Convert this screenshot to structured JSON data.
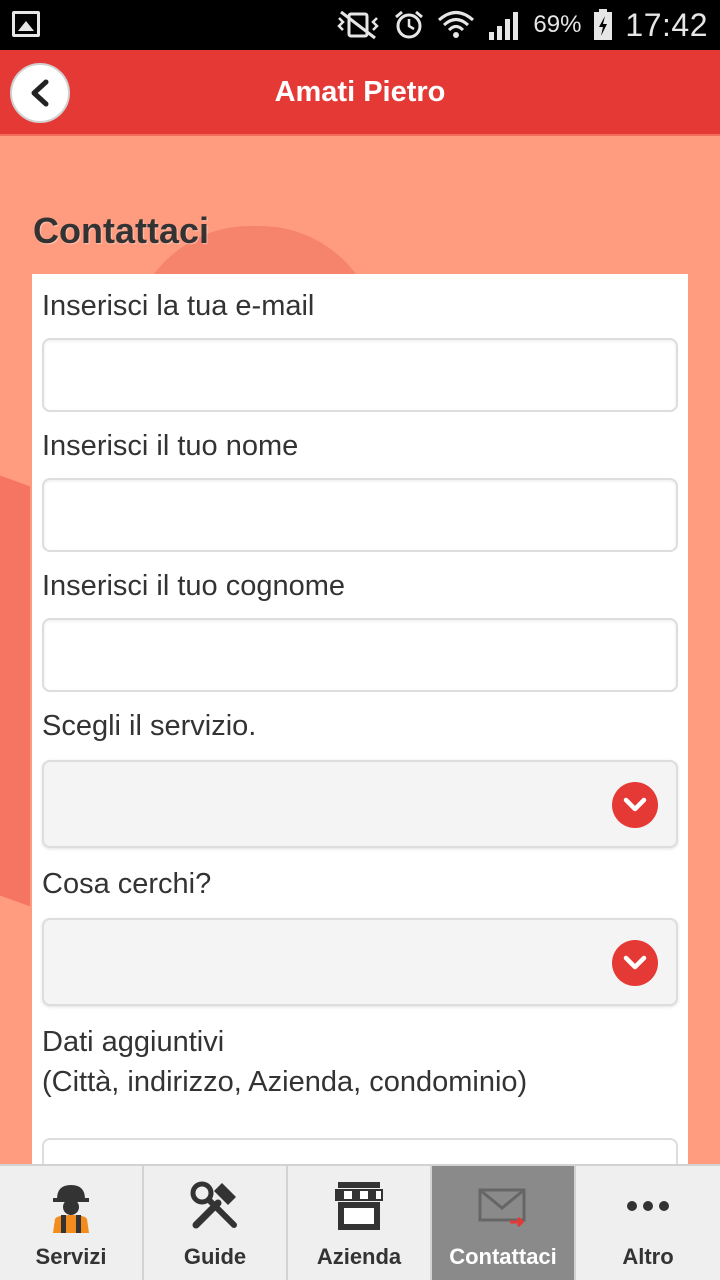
{
  "status_bar": {
    "battery_percent": "69%",
    "time": "17:42"
  },
  "header": {
    "title": "Amati Pietro"
  },
  "section": {
    "title": "Contattaci"
  },
  "form": {
    "email_label": "Inserisci la tua e-mail",
    "email_value": "",
    "name_label": "Inserisci il tuo nome",
    "name_value": "",
    "surname_label": "Inserisci il tuo cognome",
    "surname_value": "",
    "service_label": "Scegli il servizio.",
    "service_selected": "",
    "search_label": "Cosa cerchi?",
    "search_selected": "",
    "extra_label_line1": "Dati aggiuntivi",
    "extra_label_line2": "(Città, indirizzo, Azienda, condominio)"
  },
  "tabs": [
    {
      "label": "Servizi",
      "icon": "worker-icon"
    },
    {
      "label": "Guide",
      "icon": "tools-icon"
    },
    {
      "label": "Azienda",
      "icon": "shop-icon"
    },
    {
      "label": "Contattaci",
      "icon": "mail-icon",
      "active": true
    },
    {
      "label": "Altro",
      "icon": "more-icon"
    }
  ],
  "colors": {
    "primary": "#e53935",
    "background": "#ff9c80",
    "active_tab": "#8a8a8a"
  }
}
